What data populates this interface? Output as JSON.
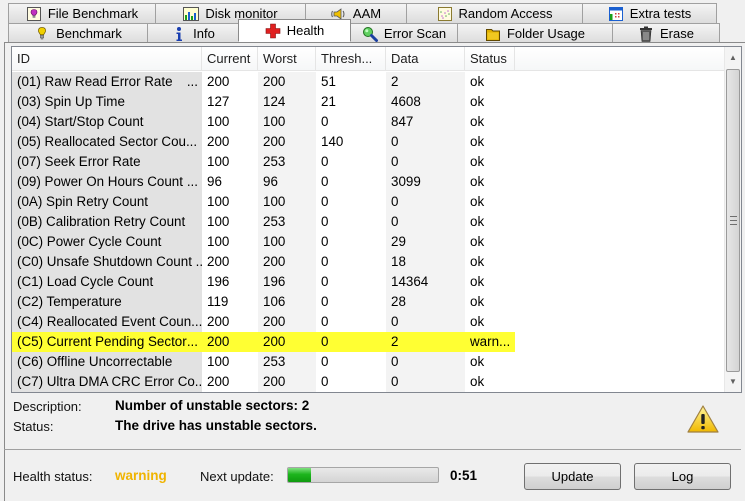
{
  "tabs": {
    "row1": [
      {
        "label": "File Benchmark",
        "icon": "file-benchmark-icon"
      },
      {
        "label": "Disk monitor",
        "icon": "disk-monitor-icon"
      },
      {
        "label": "AAM",
        "icon": "speaker-icon"
      },
      {
        "label": "Random Access",
        "icon": "random-access-icon"
      },
      {
        "label": "Extra tests",
        "icon": "extra-tests-icon"
      }
    ],
    "row2": [
      {
        "label": "Benchmark",
        "icon": "benchmark-icon"
      },
      {
        "label": "Info",
        "icon": "info-icon"
      },
      {
        "label": "Health",
        "icon": "health-cross-icon",
        "active": true
      },
      {
        "label": "Error Scan",
        "icon": "magnifier-icon"
      },
      {
        "label": "Folder Usage",
        "icon": "folder-icon"
      },
      {
        "label": "Erase",
        "icon": "trash-icon"
      }
    ]
  },
  "table": {
    "columns": [
      "ID",
      "Current",
      "Worst",
      "Thresh...",
      "Data",
      "Status"
    ],
    "rows": [
      {
        "id": "(01) Raw Read Error Rate",
        "ell": "...",
        "current": "200",
        "worst": "200",
        "thresh": "51",
        "data": "2",
        "status": "ok"
      },
      {
        "id": "(03) Spin Up Time",
        "ell": "",
        "current": "127",
        "worst": "124",
        "thresh": "21",
        "data": "4608",
        "status": "ok"
      },
      {
        "id": "(04) Start/Stop Count",
        "ell": "",
        "current": "100",
        "worst": "100",
        "thresh": "0",
        "data": "847",
        "status": "ok"
      },
      {
        "id": "(05) Reallocated Sector Cou...",
        "ell": "",
        "current": "200",
        "worst": "200",
        "thresh": "140",
        "data": "0",
        "status": "ok"
      },
      {
        "id": "(07) Seek Error Rate",
        "ell": "",
        "current": "100",
        "worst": "253",
        "thresh": "0",
        "data": "0",
        "status": "ok"
      },
      {
        "id": "(09) Power On Hours Count",
        "ell": "...",
        "current": "96",
        "worst": "96",
        "thresh": "0",
        "data": "3099",
        "status": "ok"
      },
      {
        "id": "(0A) Spin Retry Count",
        "ell": "",
        "current": "100",
        "worst": "100",
        "thresh": "0",
        "data": "0",
        "status": "ok"
      },
      {
        "id": "(0B) Calibration Retry Count",
        "ell": "",
        "current": "100",
        "worst": "253",
        "thresh": "0",
        "data": "0",
        "status": "ok"
      },
      {
        "id": "(0C) Power Cycle Count",
        "ell": "",
        "current": "100",
        "worst": "100",
        "thresh": "0",
        "data": "29",
        "status": "ok"
      },
      {
        "id": "(C0) Unsafe Shutdown Count ...",
        "ell": "",
        "current": "200",
        "worst": "200",
        "thresh": "0",
        "data": "18",
        "status": "ok"
      },
      {
        "id": "(C1) Load Cycle Count",
        "ell": "",
        "current": "196",
        "worst": "196",
        "thresh": "0",
        "data": "14364",
        "status": "ok"
      },
      {
        "id": "(C2) Temperature",
        "ell": "",
        "current": "119",
        "worst": "106",
        "thresh": "0",
        "data": "28",
        "status": "ok"
      },
      {
        "id": "(C4) Reallocated Event Coun...",
        "ell": "",
        "current": "200",
        "worst": "200",
        "thresh": "0",
        "data": "0",
        "status": "ok"
      },
      {
        "id": "(C5) Current Pending Sector",
        "ell": "...",
        "current": "200",
        "worst": "200",
        "thresh": "0",
        "data": "2",
        "status": "warn...",
        "highlight": true
      },
      {
        "id": "(C6) Offline Uncorrectable",
        "ell": "",
        "current": "100",
        "worst": "253",
        "thresh": "0",
        "data": "0",
        "status": "ok"
      },
      {
        "id": "(C7) Ultra DMA CRC Error Co...",
        "ell": "",
        "current": "200",
        "worst": "200",
        "thresh": "0",
        "data": "0",
        "status": "ok"
      }
    ],
    "highlight_color": "#ffff33"
  },
  "details": {
    "description_label": "Description:",
    "description_value": "Number of unstable sectors: 2",
    "status_label": "Status:",
    "status_value": "The drive has unstable sectors."
  },
  "footer": {
    "health_label": "Health status:",
    "health_value": "warning",
    "health_color": "#f0b400",
    "next_update_label": "Next update:",
    "next_update_progress_percent": 15,
    "next_update_time": "0:51",
    "update_button": "Update",
    "log_button": "Log"
  }
}
